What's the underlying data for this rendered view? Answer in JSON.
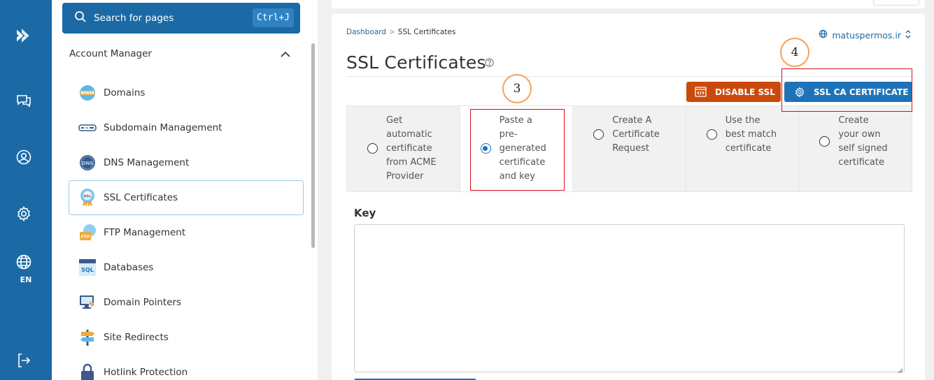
{
  "rail": {
    "icons": [
      "logo-icon",
      "chat-icon",
      "user-icon",
      "settings-icon",
      "globe-icon",
      "logout-icon"
    ],
    "language": "EN",
    "color": "#1b6aa6"
  },
  "sidebar": {
    "search": {
      "placeholder": "Search for pages",
      "shortcut": "Ctrl+J"
    },
    "section_title": "Account Manager",
    "items": [
      {
        "label": "Domains",
        "icon": "www-icon"
      },
      {
        "label": "Subdomain Management",
        "icon": "subdomain-icon"
      },
      {
        "label": "DNS Management",
        "icon": "dns-icon"
      },
      {
        "label": "SSL Certificates",
        "icon": "ssl-badge-icon",
        "active": true
      },
      {
        "label": "FTP Management",
        "icon": "ftp-icon"
      },
      {
        "label": "Databases",
        "icon": "sql-icon"
      },
      {
        "label": "Domain Pointers",
        "icon": "pointer-monitor-icon"
      },
      {
        "label": "Site Redirects",
        "icon": "signpost-icon"
      },
      {
        "label": "Hotlink Protection",
        "icon": "lock-icon"
      }
    ]
  },
  "main": {
    "breadcrumb": {
      "home": "Dashboard",
      "separator": ">",
      "current": "SSL Certificates"
    },
    "domain_selector": "matuspermos.ir",
    "title": "SSL Certificates",
    "buttons": {
      "disable_ssl": "DISABLE SSL",
      "ssl_ca_certificate": "SSL CA CERTIFICATE"
    },
    "options": [
      {
        "label": "Get automatic certificate from ACME Provider",
        "lines": [
          "Get",
          "automatic",
          "certificate",
          "from ACME",
          "Provider"
        ],
        "selected": false
      },
      {
        "label": "Paste a pre-generated certificate and key",
        "lines": [
          "Paste a",
          "pre-",
          "generated",
          "certificate",
          "and key"
        ],
        "selected": true
      },
      {
        "label": "Create A Certificate Request",
        "lines": [
          "Create A",
          "Certificate",
          "Request"
        ],
        "selected": false
      },
      {
        "label": "Use the best match certificate",
        "lines": [
          "Use the",
          "best match",
          "certificate"
        ],
        "selected": false
      },
      {
        "label": "Create your own self signed certificate",
        "lines": [
          "Create",
          "your own",
          "self signed",
          "certificate"
        ],
        "selected": false
      }
    ],
    "key_label": "Key",
    "key_value": ""
  },
  "annotations": [
    {
      "number": "3",
      "target": "paste-pre-generated-option"
    },
    {
      "number": "4",
      "target": "ssl-ca-certificate-button"
    }
  ],
  "colors": {
    "primary": "#1e73b8",
    "danger": "#c94a0c",
    "annotation_box": "#d0131d",
    "annotation_circle": "#f2a35a"
  }
}
